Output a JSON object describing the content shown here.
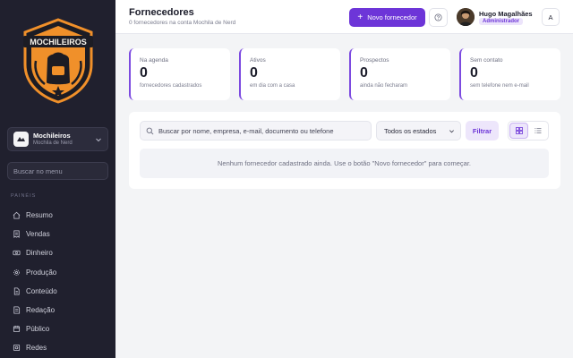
{
  "sidebar": {
    "logo_text": "MOCHILEIROS",
    "workspace": {
      "name": "Mochileiros",
      "subtitle": "Mochila de Nerd"
    },
    "search_placeholder": "Buscar no menu",
    "section_label": "PAINÉIS",
    "items": [
      {
        "label": "Resumo",
        "icon": "home-icon"
      },
      {
        "label": "Vendas",
        "icon": "receipt-icon"
      },
      {
        "label": "Dinheiro",
        "icon": "cash-icon"
      },
      {
        "label": "Produção",
        "icon": "gear-icon"
      },
      {
        "label": "Conteúdo",
        "icon": "document-icon"
      },
      {
        "label": "Redação",
        "icon": "edit-icon"
      },
      {
        "label": "Público",
        "icon": "calendar-icon"
      },
      {
        "label": "Redes",
        "icon": "share-icon"
      }
    ]
  },
  "header": {
    "title": "Fornecedores",
    "subtitle": "0 fornecedores na conta Mochila de Nerd",
    "new_button": "Novo fornecedor",
    "user_name": "Hugo Magalhães",
    "user_role": "Administrador",
    "avatar_letter": "A"
  },
  "stats": [
    {
      "label": "Na agenda",
      "value": "0",
      "desc": "fornecedores cadastrados"
    },
    {
      "label": "Ativos",
      "value": "0",
      "desc": "em dia com a casa"
    },
    {
      "label": "Prospectos",
      "value": "0",
      "desc": "ainda não fecharam"
    },
    {
      "label": "Sem contato",
      "value": "0",
      "desc": "sem telefone nem e-mail"
    }
  ],
  "filters": {
    "search_placeholder": "Buscar por nome, empresa, e-mail, documento ou telefone",
    "state_select": "Todos os estados",
    "filter_button": "Filtrar"
  },
  "empty_message": "Nenhum fornecedor cadastrado ainda. Use o botão \"Novo fornecedor\" para começar.",
  "colors": {
    "accent": "#6d35d8",
    "sidebar_bg": "#20202e",
    "logo_orange": "#f0902a"
  }
}
